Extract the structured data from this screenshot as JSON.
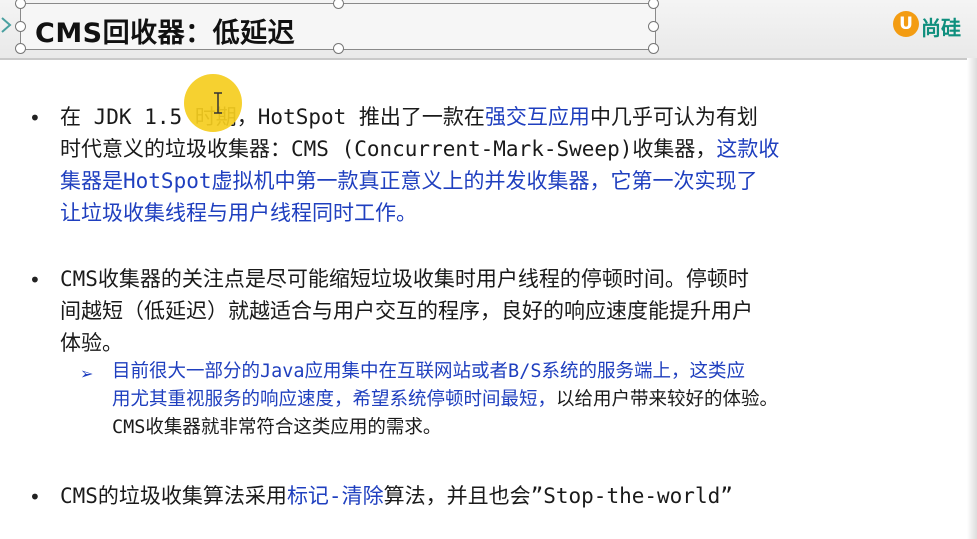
{
  "slide": {
    "title": "CMS回收器：低延迟",
    "logo_text": "尚硅",
    "logo_mark": "U"
  },
  "bullets": [
    {
      "lines": [
        [
          {
            "t": "在 JDK 1.5 时期，HotSpot 推出了一款在"
          },
          {
            "t": "强交互应用",
            "blue": true
          },
          {
            "t": "中几乎可认为有划"
          }
        ],
        [
          {
            "t": "时代意义的垃圾收集器：CMS (Concurrent-Mark-Sweep)收集器，"
          },
          {
            "t": "这款收",
            "blue": true
          }
        ],
        [
          {
            "t": "集器是HotSpot虚拟机中第一款真正意义上的并发收集器，它第一次实现了",
            "blue": true
          }
        ],
        [
          {
            "t": "让垃圾收集线程与用户线程同时工作。",
            "blue": true
          }
        ]
      ]
    },
    {
      "lines": [
        [
          {
            "t": "CMS收集器的关注点是尽可能缩短垃圾收集时用户线程的停顿时间。停顿时"
          }
        ],
        [
          {
            "t": "间越短（低延迟）就越适合与用户交互的程序，良好的响应速度能提升用户"
          }
        ],
        [
          {
            "t": "体验。"
          }
        ]
      ],
      "sub": {
        "marker": "➢",
        "lines": [
          [
            {
              "t": "目前很大一部分的Java应用集中在互联网站或者B/S系统的服务端上，这类应",
              "blue": true
            }
          ],
          [
            {
              "t": "用尤其重视服务的响应速度，希望系统停顿时间最短，",
              "blue": true
            },
            {
              "t": "以给用户带来较好的体验。"
            }
          ],
          [
            {
              "t": "CMS收集器就非常符合这类应用的需求。"
            }
          ]
        ]
      }
    },
    {
      "lines": [
        [
          {
            "t": "CMS的垃圾收集算法采用"
          },
          {
            "t": "标记-清除",
            "blue": true
          },
          {
            "t": "算法，并且也会”Stop-the-world”"
          }
        ]
      ]
    }
  ],
  "bullet_marker": "•"
}
